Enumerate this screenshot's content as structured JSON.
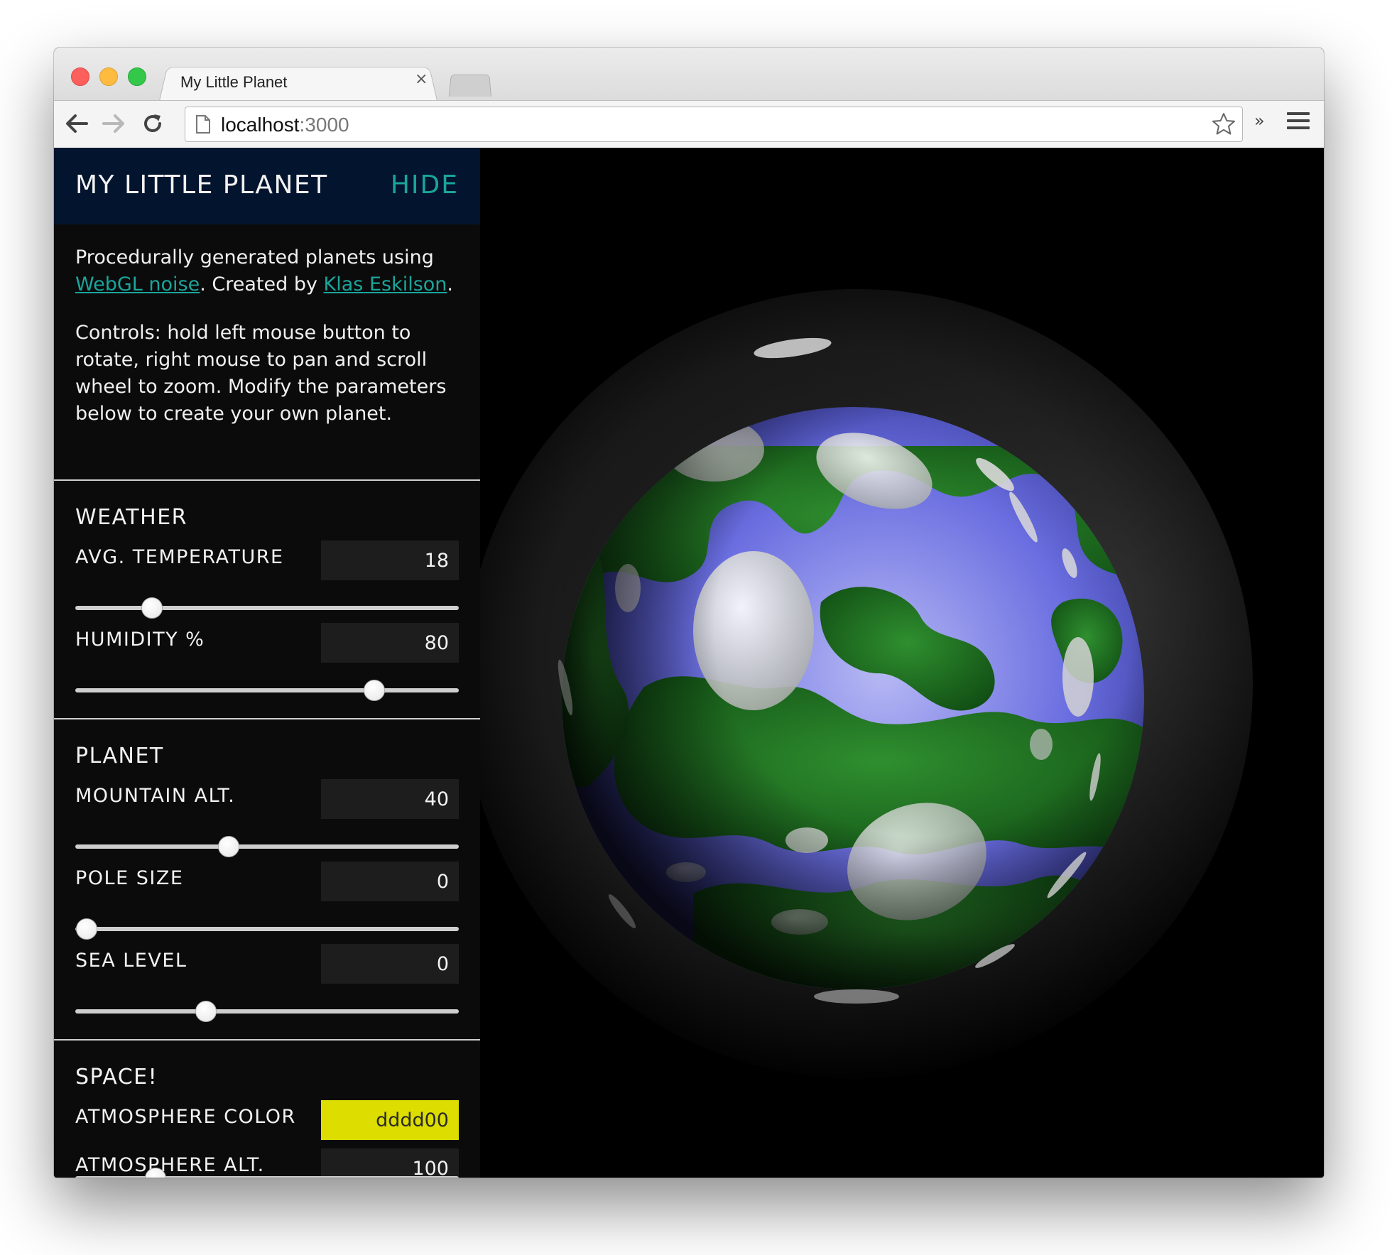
{
  "browser": {
    "tab_title": "My Little Planet",
    "tab_close": "×",
    "url_host": "localhost",
    "url_port": ":3000",
    "extensions_chevron": "»"
  },
  "panel": {
    "title": "MY LITTLE PLANET",
    "hide_label": "HIDE",
    "intro": {
      "line1_text": "Procedurally generated planets using ",
      "webgl_link": "WebGL noise",
      "created_by": ". Created by ",
      "author_link": "Klas Eskilson",
      "end": ".",
      "controls": "Controls: hold left mouse button to rotate, right mouse to pan and scroll wheel to zoom. Modify the parameters below to create your own planet."
    },
    "sections": {
      "weather": {
        "title": "WEATHER",
        "avg_temperature": {
          "label": "AVG. TEMPERATURE",
          "value": "18",
          "fraction": 0.2
        },
        "humidity": {
          "label": "HUMIDITY %",
          "value": "80",
          "fraction": 0.78
        }
      },
      "planet": {
        "title": "PLANET",
        "mountain_alt": {
          "label": "MOUNTAIN ALT.",
          "value": "40",
          "fraction": 0.4
        },
        "pole_size": {
          "label": "POLE SIZE",
          "value": "0",
          "fraction": 0.03
        },
        "sea_level": {
          "label": "SEA LEVEL",
          "value": "0",
          "fraction": 0.34
        }
      },
      "space": {
        "title": "SPACE!",
        "atmosphere_color": {
          "label": "ATMOSPHERE COLOR",
          "value": "dddd00",
          "color": "#dddd00"
        },
        "atmosphere_alt": {
          "label": "ATMOSPHERE ALT.",
          "value": "100",
          "fraction": 0.21
        }
      }
    }
  },
  "colors": {
    "accent": "#1aa59c",
    "header_bg": "#03142e",
    "panel_bg": "#0b0b0b",
    "land": "#1f7a1f",
    "water": "#6a6ee0",
    "cloud": "#e8ece8"
  }
}
